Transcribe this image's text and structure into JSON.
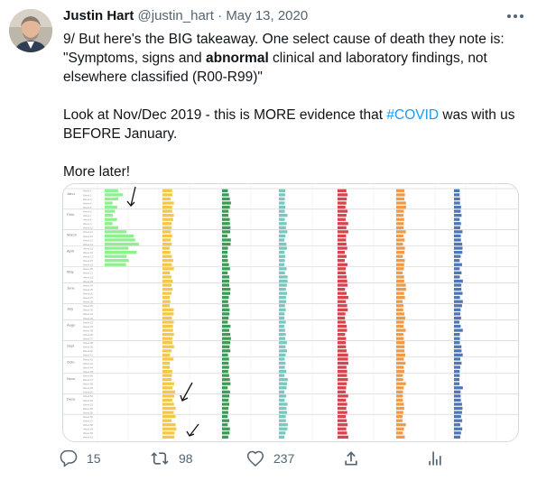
{
  "author": {
    "name": "Justin Hart",
    "handle": "@justin_hart",
    "separator": "·",
    "date": "May 13, 2020"
  },
  "tweet": {
    "line1_a": "9/ But here's the BIG takeaway. One select cause of death they note is: \"Symptoms, signs and ",
    "line1_bold": "abnormal",
    "line1_b": " clinical and laboratory findings, not elsewhere classified (R00-R99)\"",
    "line2_a": "Look at Nov/Dec 2019 - this is MORE evidence that ",
    "hashtag": "#COVID",
    "line2_b": " was with us BEFORE January.",
    "line3": "More later!"
  },
  "media": {
    "months": [
      "Janu",
      "Febr",
      "March",
      "April",
      "May",
      "June",
      "July",
      "Augu",
      "Sept",
      "Octo",
      "Nove",
      "Dece"
    ],
    "colors": {
      "green": "#8ff08f",
      "yellow": "#f3c84a",
      "teal_green": "#3f9a55",
      "teal": "#7ac7c0",
      "red": "#d9434b",
      "orange": "#f09a45",
      "blue": "#4f77b7",
      "grid": "#d6d6d6"
    }
  },
  "actions": {
    "replies": "15",
    "retweets": "98",
    "likes": "237"
  },
  "icons": [
    "reply-icon",
    "retweet-icon",
    "like-icon",
    "share-icon",
    "analytics-icon",
    "more-icon"
  ]
}
